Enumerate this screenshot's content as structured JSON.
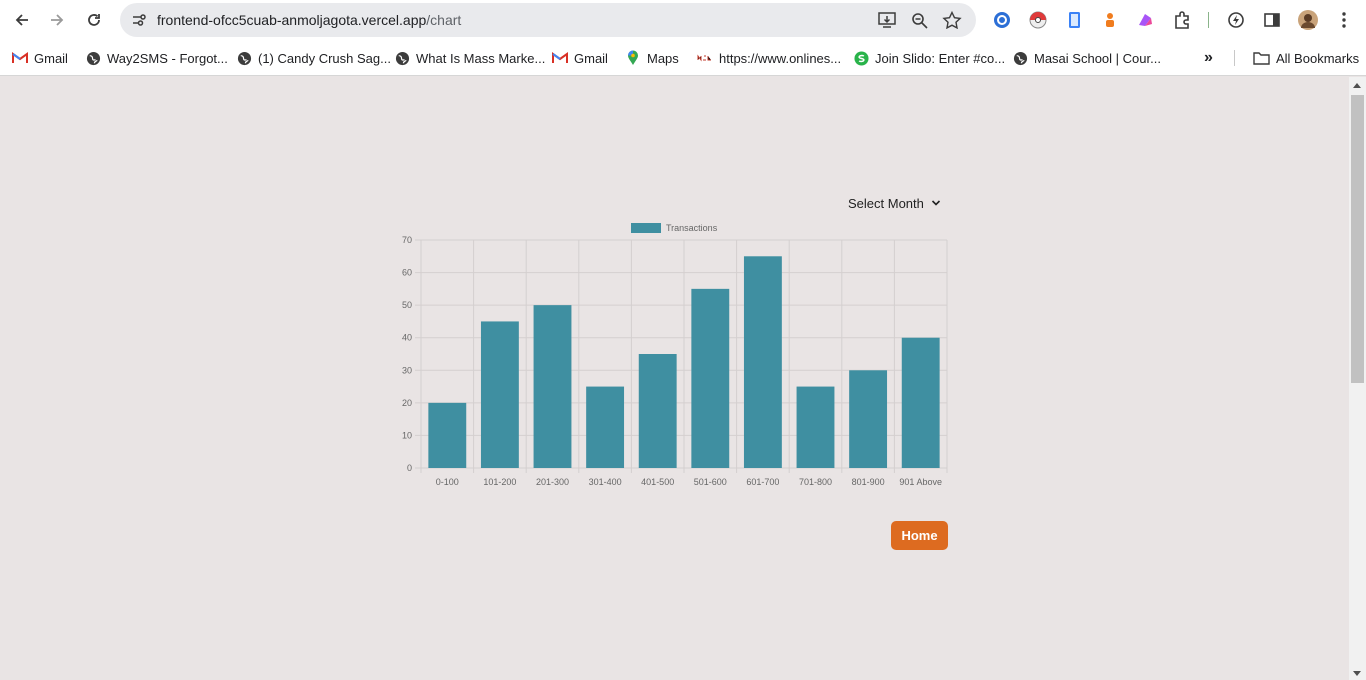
{
  "browser": {
    "url_host": "frontend-ofcc5cuab-anmoljagota.vercel.app",
    "url_path": "/chart",
    "bookmarks": [
      {
        "label": "Gmail",
        "icon": "gmail-icon"
      },
      {
        "label": "Way2SMS - Forgot...",
        "icon": "globe-icon"
      },
      {
        "label": "(1) Candy Crush Sag...",
        "icon": "globe-icon"
      },
      {
        "label": "What Is Mass Marke...",
        "icon": "globe-icon"
      },
      {
        "label": "Gmail",
        "icon": "gmail-icon"
      },
      {
        "label": "Maps",
        "icon": "maps-pin-icon"
      },
      {
        "label": "https://www.onlines...",
        "icon": "nsdl-icon"
      },
      {
        "label": "Join Slido: Enter #co...",
        "icon": "slido-icon"
      },
      {
        "label": "Masai School | Cour...",
        "icon": "globe-icon"
      }
    ],
    "more_bookmarks": "»",
    "all_bookmarks": "All Bookmarks"
  },
  "page": {
    "select_month": "Select Month",
    "home_button": "Home"
  },
  "chart_data": {
    "type": "bar",
    "categories": [
      "0-100",
      "101-200",
      "201-300",
      "301-400",
      "401-500",
      "501-600",
      "601-700",
      "701-800",
      "801-900",
      "901 Above"
    ],
    "series": [
      {
        "name": "Transactions",
        "values": [
          20,
          45,
          50,
          25,
          35,
          55,
          65,
          25,
          30,
          40
        ],
        "color": "#3f8fa1"
      }
    ],
    "ylim": [
      0,
      70
    ],
    "yticks": [
      0,
      10,
      20,
      30,
      40,
      50,
      60,
      70
    ],
    "grid": true,
    "legend": "top-center"
  }
}
